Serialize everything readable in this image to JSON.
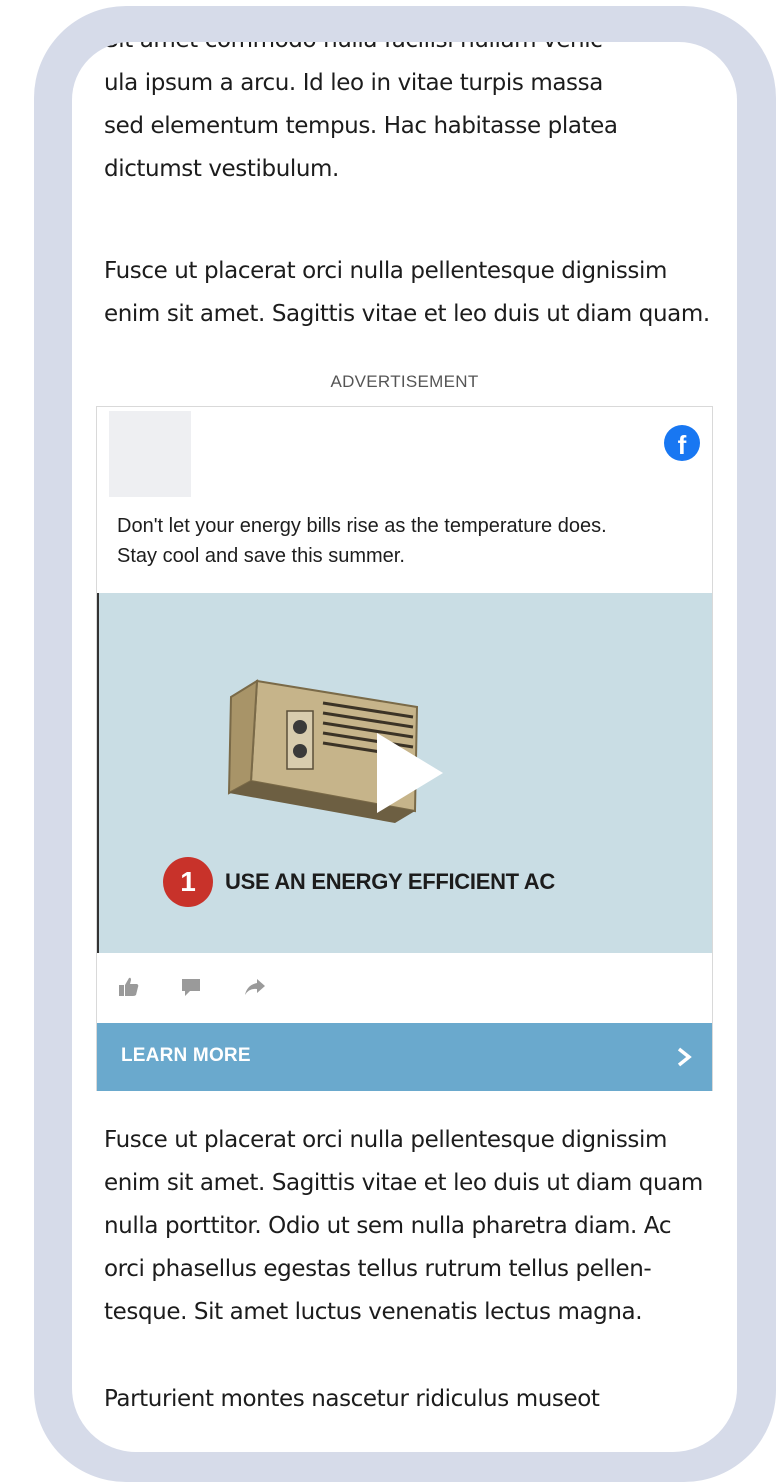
{
  "article": {
    "para_top": [
      "Sit amet commodo nulla facilisi nullam venic",
      "ula ipsum a arcu. Id leo in vitae turpis massa",
      "sed elementum tempus. Hac habitasse platea",
      "dictumst vestibulum."
    ],
    "para_2": [
      "Fusce ut placerat orci nulla pellentesque dignissim",
      "enim sit amet. Sagittis vitae et leo duis ut diam quam."
    ],
    "para_3": [
      "Fusce ut placerat orci nulla pellentesque dignissim",
      "enim sit amet. Sagittis vitae et leo duis ut diam quam",
      "nulla porttitor. Odio ut sem nulla pharetra diam. Ac",
      "orci phasellus egestas tellus rutrum tellus pellen-",
      "tesque. Sit amet luctus venenatis lectus magna."
    ],
    "para_4": [
      "Parturient montes nascetur ridiculus museot"
    ]
  },
  "ad": {
    "label": "ADVERTISEMENT",
    "platform_icon": "facebook-icon",
    "platform_glyph": "f",
    "copy": [
      "Don't let your energy bills rise as the temperature does.",
      "Stay cool and save this summer."
    ],
    "video": {
      "step_number": "1",
      "step_title": "USE AN ENERGY EFFICIENT AC"
    },
    "actions": [
      "like-icon",
      "comment-icon",
      "share-icon"
    ],
    "cta_label": "LEARN MORE"
  },
  "colors": {
    "frame": "#d6dbe9",
    "facebook_blue": "#1877f2",
    "video_bg": "#c9dde4",
    "badge_red": "#c8322a",
    "cta_blue": "#6aa9cd"
  }
}
